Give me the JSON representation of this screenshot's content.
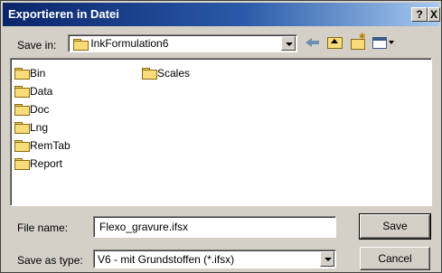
{
  "window": {
    "title": "Exportieren in Datei",
    "help_glyph": "?",
    "close_glyph": "X"
  },
  "toolbar": {
    "save_in_label": "Save in:",
    "save_in_value": "InkFormulation6",
    "icons": [
      "back-icon",
      "up-folder-icon",
      "new-folder-icon",
      "view-menu-icon"
    ]
  },
  "file_list": {
    "items": [
      {
        "name": "Bin",
        "type": "folder"
      },
      {
        "name": "Data",
        "type": "folder"
      },
      {
        "name": "Doc",
        "type": "folder"
      },
      {
        "name": "Lng",
        "type": "folder"
      },
      {
        "name": "RemTab",
        "type": "folder"
      },
      {
        "name": "Report",
        "type": "folder"
      },
      {
        "name": "Scales",
        "type": "folder"
      }
    ]
  },
  "form": {
    "file_name_label": "File name:",
    "file_name_value": "Flexo_gravure.ifsx",
    "save_as_type_label": "Save as type:",
    "save_as_type_value": "V6 - mit Grundstoffen (*.ifsx)"
  },
  "buttons": {
    "save_label": "Save",
    "cancel_label": "Cancel"
  }
}
